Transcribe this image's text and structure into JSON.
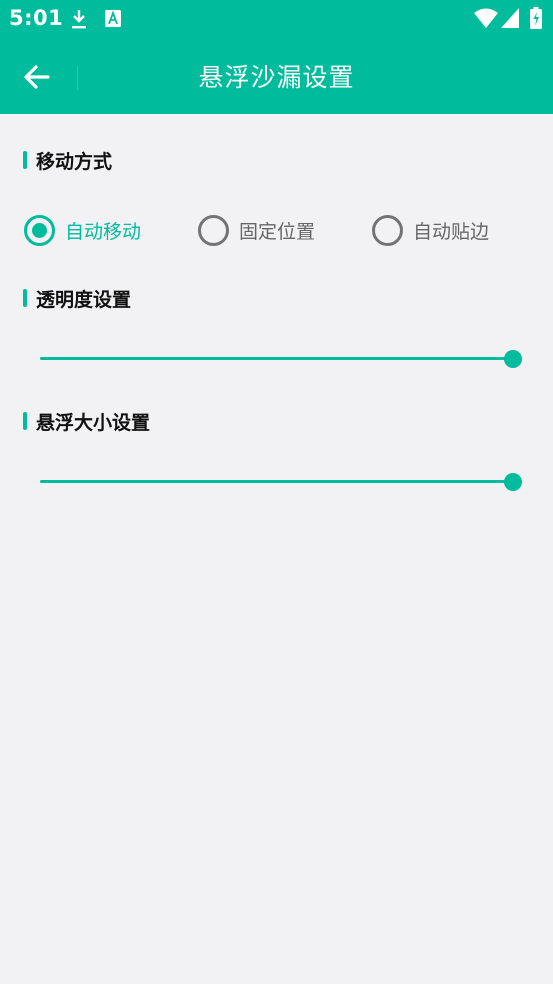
{
  "status_bar": {
    "time": "5:01",
    "icons": [
      "download-icon",
      "font-a-icon",
      "wifi-icon",
      "signal-icon",
      "battery-icon"
    ]
  },
  "app_bar": {
    "title": "悬浮沙漏设置",
    "back_icon": "arrow-left-icon"
  },
  "colors": {
    "accent": "#00bc9c",
    "background": "#f2f2f4",
    "unchecked": "#737373"
  },
  "sections": {
    "move_mode": {
      "title": "移动方式",
      "options": [
        {
          "label": "自动移动",
          "checked": true
        },
        {
          "label": "固定位置",
          "checked": false
        },
        {
          "label": "自动贴边",
          "checked": false
        }
      ]
    },
    "opacity": {
      "title": "透明度设置",
      "value_fraction": 1.0
    },
    "size": {
      "title": "悬浮大小设置",
      "value_fraction": 1.0
    }
  }
}
